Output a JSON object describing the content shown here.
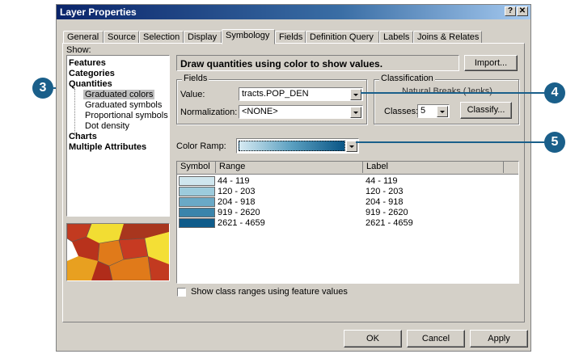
{
  "window": {
    "title": "Layer Properties",
    "help_label": "?",
    "close_label": "✕"
  },
  "tabs": [
    "General",
    "Source",
    "Selection",
    "Display",
    "Symbology",
    "Fields",
    "Definition Query",
    "Labels",
    "Joins & Relates"
  ],
  "active_tab": "Symbology",
  "show": {
    "label": "Show:",
    "items": [
      {
        "label": "Features",
        "bold": true
      },
      {
        "label": "Categories",
        "bold": true
      },
      {
        "label": "Quantities",
        "bold": true
      },
      {
        "label": "Graduated colors",
        "selected": true
      },
      {
        "label": "Graduated symbols"
      },
      {
        "label": "Proportional symbols"
      },
      {
        "label": "Dot density"
      },
      {
        "label": "Charts",
        "bold": true
      },
      {
        "label": "Multiple Attributes",
        "bold": true
      }
    ]
  },
  "heading": "Draw quantities using color to show values.",
  "import_label": "Import...",
  "fields": {
    "group_label": "Fields",
    "value_label": "Value:",
    "value": "tracts.POP_DEN",
    "normalization_label": "Normalization:",
    "normalization": "<NONE>"
  },
  "classification": {
    "group_label": "Classification",
    "method": "Natural Breaks (Jenks)",
    "classes_label": "Classes:",
    "classes": "5",
    "classify_label": "Classify..."
  },
  "color_ramp_label": "Color Ramp:",
  "ramp_colors": [
    "#d6eaf2",
    "#5a9fc0",
    "#0a5686"
  ],
  "table": {
    "headers": [
      "Symbol",
      "Range",
      "Label"
    ],
    "rows": [
      {
        "color": "#cfe6ee",
        "range": "44 - 119",
        "label": "44 - 119"
      },
      {
        "color": "#9ccbdc",
        "range": "120 - 203",
        "label": "120 - 203"
      },
      {
        "color": "#6aa9c6",
        "range": "204 - 918",
        "label": "204 - 918"
      },
      {
        "color": "#3a84ab",
        "range": "919 - 2620",
        "label": "919 - 2620"
      },
      {
        "color": "#0e5b8a",
        "range": "2621 - 4659",
        "label": "2621 - 4659"
      }
    ]
  },
  "show_class_ranges_label": "Show class ranges using feature values",
  "buttons": {
    "ok": "OK",
    "cancel": "Cancel",
    "apply": "Apply"
  },
  "callouts": [
    "3",
    "4",
    "5"
  ]
}
